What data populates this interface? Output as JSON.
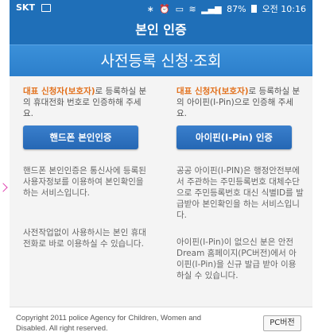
{
  "status_bar": {
    "carrier": "SKT",
    "battery": "87%",
    "time": "오전 10:16",
    "icons": [
      "sim-card-icon",
      "bluetooth-icon",
      "alarm-icon",
      "hd-icon",
      "wifi-icon",
      "signal-icon",
      "battery-icon"
    ]
  },
  "header": {
    "title": "본인 인증",
    "subtitle": "사전등록 신청·조회"
  },
  "phone_auth": {
    "intro_highlight": "대표 신청자(보호자)",
    "intro_rest": "로 등록하실 분의 휴대전화 번호로 인증하해 주세요.",
    "button_label": "핸드폰 본인인증",
    "desc1": "핸드폰 본인인증은 통신사에 등록된 사용자정보를 이용하여 본인확인을 하는 서비스입니다.",
    "desc2": "사전작업없이 사용하시는 본인 휴대전화로 바로 이용하실 수 있습니다."
  },
  "ipin_auth": {
    "intro_highlight": "대표 신청자(보호자)",
    "intro_rest": "로 등록하실 분의 아이핀(I-Pin)으로 인증해 주세요.",
    "button_label": "아이핀(I-Pin) 인증",
    "desc1": "공공 아이핀(I-PIN)은 행정안전부에서 주관하는 주민등록번호 대체수단으로 주민등록번호 대신 식별ID를 발급받아 본인확인을 하는 서비스입니다.",
    "desc2": "아이핀(I-Pin)이 없으신 분은 안전Dream 홈페이지(PC버전)에서 아이핀(I-Pin)을 신규 발급 받아 이용하실 수 있습니다."
  },
  "footer": {
    "copyright": "Copyright 2011 police Agency for Children, Women and Disabled. All right reserved.",
    "pc_button": "PC버전"
  },
  "colors": {
    "header_blue": "#1f6fb8",
    "button_blue": "#2567b4",
    "highlight_orange": "#e2701c"
  }
}
